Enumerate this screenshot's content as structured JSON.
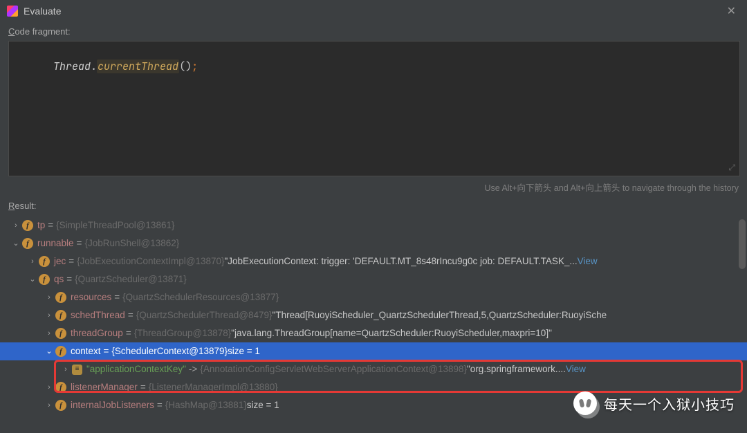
{
  "titlebar": {
    "title": "Evaluate"
  },
  "labels": {
    "code_fragment": "Code fragment:",
    "result": "Result:"
  },
  "code": {
    "type": "Thread",
    "dot": ".",
    "method": "currentThread",
    "parens": "()",
    "semi": ";"
  },
  "hint": "Use Alt+向下箭头 and Alt+向上箭头 to navigate through the history",
  "rows": [
    {
      "indent": 0,
      "arrow": "right",
      "icon": "f",
      "name": "tp",
      "eq": " = ",
      "obj": "{SimpleThreadPool@13861}"
    },
    {
      "indent": 0,
      "arrow": "down",
      "icon": "f",
      "name": "runnable",
      "eq": " = ",
      "obj": "{JobRunShell@13862}"
    },
    {
      "indent": 1,
      "arrow": "right",
      "icon": "f",
      "name": "jec",
      "eq": " = ",
      "obj": "{JobExecutionContextImpl@13870}",
      "str": " \"JobExecutionContext: trigger: 'DEFAULT.MT_8s48rIncu9g0c job: DEFAULT.TASK_...",
      "link": " View"
    },
    {
      "indent": 1,
      "arrow": "down",
      "icon": "f",
      "name": "qs",
      "eq": " = ",
      "obj": "{QuartzScheduler@13871}"
    },
    {
      "indent": 2,
      "arrow": "right",
      "icon": "f",
      "name": "resources",
      "eq": " = ",
      "obj": "{QuartzSchedulerResources@13877}"
    },
    {
      "indent": 2,
      "arrow": "right",
      "icon": "f",
      "name": "schedThread",
      "eq": " = ",
      "obj": "{QuartzSchedulerThread@8479}",
      "str": " \"Thread[RuoyiScheduler_QuartzSchedulerThread,5,QuartzScheduler:RuoyiSche"
    },
    {
      "indent": 2,
      "arrow": "right",
      "icon": "f",
      "name": "threadGroup",
      "eq": " = ",
      "obj": "{ThreadGroup@13878}",
      "str": " \"java.lang.ThreadGroup[name=QuartzScheduler:RuoyiScheduler,maxpri=10]\""
    },
    {
      "indent": 2,
      "arrow": "down",
      "icon": "f",
      "name": "context",
      "eq": " = ",
      "obj": "{SchedulerContext@13879}",
      "size": "  size = 1",
      "selected": true
    },
    {
      "indent": 3,
      "arrow": "right",
      "icon": "map",
      "keyname": "\"applicationContextKey\"",
      "mapto": " -> ",
      "obj": "{AnnotationConfigServletWebServerApplicationContext@13898}",
      "str": " \"org.springframework....",
      "link": " View"
    },
    {
      "indent": 2,
      "arrow": "right",
      "icon": "f",
      "name": "listenerManager",
      "eq": " = ",
      "obj": "{ListenerManagerImpl@13880}"
    },
    {
      "indent": 2,
      "arrow": "right",
      "icon": "f",
      "name": "internalJobListeners",
      "eq": " = ",
      "obj": "{HashMap@13881}",
      "size": "  size = 1"
    }
  ],
  "watermark": "每天一个入狱小技巧"
}
